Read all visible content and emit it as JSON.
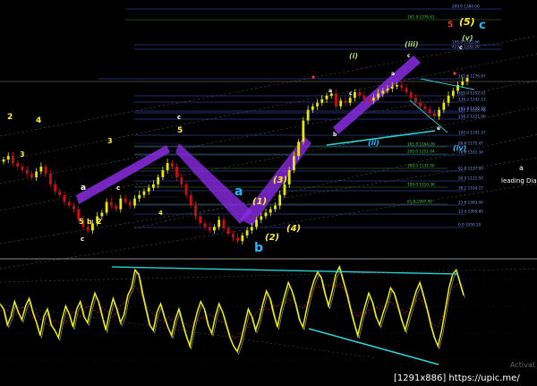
{
  "colors": {
    "background": "#000000",
    "candle_up": "#e8e800",
    "candle_down": "#cc1010",
    "wedge": "#8a2be2",
    "trendline": "#2ad4d4",
    "oscillator": "#f0f000",
    "osc_shadow": "#bbbbbb",
    "signal": "#cc2222",
    "fib_line": "#2a3a8c",
    "fib_text_blue": "#7f8fe8",
    "fib_text_green": "#44cc44",
    "label_yellow": "#ffee33",
    "label_cyan": "#22b8ff",
    "label_green": "#a8d860",
    "label_red": "#ff3030",
    "text_white": "#ffffff"
  },
  "fib_levels": [
    {
      "value": "200.0 1384.00",
      "color": "blue"
    },
    {
      "value": "161.8 1376.61",
      "color": "green"
    },
    {
      "value": "423.6 1335.30",
      "color": "blue"
    },
    {
      "value": "195.0 1322.66",
      "color": "blue"
    },
    {
      "value": "161.8 1276.87",
      "color": "blue"
    },
    {
      "value": "300.0 1252.41",
      "color": "blue"
    },
    {
      "value": "138.2 1242.53",
      "color": "blue"
    },
    {
      "value": "261.8 1229.90",
      "color": "blue"
    },
    {
      "value": "127.2 1228.48",
      "color": "blue"
    },
    {
      "value": "238.2 1221.90",
      "color": "blue"
    },
    {
      "value": "100.0 1191.37",
      "color": "blue"
    },
    {
      "value": "88.6 1175.47",
      "color": "blue"
    },
    {
      "value": "78.6 1161.34",
      "color": "blue"
    },
    {
      "value": "61.8 1137.00",
      "color": "blue"
    },
    {
      "value": "50.0 1121.50",
      "color": "blue"
    },
    {
      "value": "38.2 1104.27",
      "color": "blue"
    },
    {
      "value": "23.6 1083.44",
      "color": "blue"
    },
    {
      "value": "13.4 1069.80",
      "color": "blue"
    },
    {
      "value": "0.0 1050.20",
      "color": "blue"
    },
    {
      "value": "161.8 1164.28",
      "color": "green"
    },
    {
      "value": "200.0 1151.04",
      "color": "green"
    },
    {
      "value": "300.0 1131.00",
      "color": "green"
    },
    {
      "value": "100.0 1110.36",
      "color": "green"
    },
    {
      "value": "61.8 1097.40",
      "color": "green"
    }
  ],
  "wave_labels": [
    {
      "text": "2",
      "color": "yellow"
    },
    {
      "text": "4",
      "color": "yellow"
    },
    {
      "text": "3",
      "color": "yellow"
    },
    {
      "text": "a",
      "color": "white"
    },
    {
      "text": "5",
      "color": "yellow"
    },
    {
      "text": "b",
      "color": "yellow"
    },
    {
      "text": "2",
      "color": "yellow"
    },
    {
      "text": "c",
      "color": "white"
    },
    {
      "text": "3",
      "color": "yellow"
    },
    {
      "text": "c",
      "color": "white"
    },
    {
      "text": "4",
      "color": "yellow"
    },
    {
      "text": "5",
      "color": "yellow"
    },
    {
      "text": "c",
      "color": "white"
    },
    {
      "text": "a",
      "color": "cyan"
    },
    {
      "text": "b",
      "color": "cyan"
    },
    {
      "text": "(1)",
      "color": "yellow"
    },
    {
      "text": "(2)",
      "color": "yellow"
    },
    {
      "text": "(3)",
      "color": "yellow"
    },
    {
      "text": "(4)",
      "color": "yellow"
    },
    {
      "text": "(i)",
      "color": "green"
    },
    {
      "text": "(ii)",
      "color": "cyan"
    },
    {
      "text": "(iii)",
      "color": "green"
    },
    {
      "text": "(iv)",
      "color": "cyan"
    },
    {
      "text": "(v)",
      "color": "green"
    },
    {
      "text": "a",
      "color": "white"
    },
    {
      "text": "c",
      "color": "white"
    },
    {
      "text": "b",
      "color": "white"
    },
    {
      "text": "a",
      "color": "white"
    },
    {
      "text": "c",
      "color": "white"
    },
    {
      "text": "(5)",
      "color": "yellow"
    },
    {
      "text": "c",
      "color": "cyan"
    },
    {
      "text": "5",
      "color": "red"
    },
    {
      "text": "e",
      "color": "white"
    },
    {
      "text": "c",
      "color": "white"
    }
  ],
  "side_text": {
    "heading": "leading Dia",
    "small_a": "a"
  },
  "footer": {
    "watermark": "Activat",
    "source": "[1291x886] https://upic.me/"
  },
  "chart_data": [
    {
      "type": "candlestick",
      "title": "",
      "xlabel": "",
      "ylabel": "",
      "ylim": [
        1040,
        1400
      ],
      "y": [
        1212,
        1205,
        1198,
        1202,
        1195,
        1188,
        1192,
        1185,
        1178,
        1172,
        1166,
        1160,
        1152,
        1148,
        1142,
        1136,
        1130,
        1124,
        1118,
        1112,
        1108,
        1104,
        1096,
        1088,
        1082,
        1078,
        1084,
        1092,
        1098,
        1106,
        1114,
        1120,
        1126,
        1132,
        1138,
        1144,
        1150,
        1156,
        1160,
        1164,
        1168,
        1172,
        1176,
        1180,
        1186,
        1192,
        1198,
        1204,
        1210,
        1216,
        1220,
        1226,
        1230,
        1234,
        1238,
        1240,
        1242,
        1244,
        1246,
        1248,
        1250,
        1252,
        1254,
        1256,
        1258,
        1260,
        1262,
        1264,
        1266,
        1268
      ],
      "series": [
        {
          "name": "",
          "values": [
            1175,
            1180,
            1170,
            1165,
            1160,
            1155,
            1150,
            1158,
            1165,
            1155,
            1140,
            1130,
            1125,
            1115,
            1110,
            1105,
            1090,
            1080,
            1075,
            1085,
            1095,
            1100,
            1115,
            1110,
            1105,
            1120,
            1115,
            1110,
            1120,
            1125,
            1130,
            1135,
            1140,
            1150,
            1160,
            1170,
            1165,
            1150,
            1140,
            1125,
            1110,
            1095,
            1085,
            1080,
            1075,
            1080,
            1090,
            1078,
            1070,
            1065,
            1060,
            1068,
            1075,
            1080,
            1090,
            1095,
            1100,
            1105,
            1110,
            1125,
            1140,
            1160,
            1180,
            1200,
            1230,
            1245,
            1250,
            1255,
            1260,
            1265,
            1268,
            1250,
            1258,
            1255,
            1262,
            1270,
            1265,
            1260,
            1258,
            1262,
            1268,
            1272,
            1275,
            1278,
            1280,
            1276,
            1270,
            1262,
            1255,
            1250,
            1246,
            1240,
            1236,
            1245,
            1255,
            1265,
            1272,
            1280,
            1285,
            1290
          ]
        }
      ]
    },
    {
      "type": "line",
      "title": "",
      "xlabel": "",
      "ylabel": "",
      "ylim": [
        0,
        100
      ],
      "series": [
        {
          "name": "",
          "values": [
            60,
            55,
            40,
            48,
            62,
            52,
            45,
            58,
            65,
            52,
            42,
            30,
            48,
            55,
            40,
            35,
            28,
            45,
            58,
            50,
            38,
            55,
            62,
            48,
            42,
            58,
            70,
            62,
            48,
            35,
            52,
            65,
            55,
            42,
            50,
            68,
            75,
            92,
            88,
            70,
            55,
            40,
            35,
            52,
            60,
            48,
            38,
            30,
            45,
            55,
            42,
            30,
            20,
            38,
            52,
            62,
            55,
            40,
            32,
            48,
            60,
            52,
            40,
            28,
            20,
            15,
            25,
            40,
            55,
            48,
            35,
            45,
            60,
            72,
            65,
            50,
            38,
            55,
            68,
            80,
            72,
            60,
            45,
            38,
            55,
            70,
            82,
            90,
            85,
            70,
            58,
            72,
            88,
            95,
            82,
            70,
            55,
            42,
            30,
            45,
            58,
            70,
            62,
            48,
            40,
            52,
            62,
            75,
            70,
            58,
            45,
            35,
            48,
            60,
            72,
            80,
            68,
            55,
            40,
            28,
            20,
            35,
            55,
            75,
            88,
            92,
            80,
            68
          ]
        }
      ]
    }
  ]
}
